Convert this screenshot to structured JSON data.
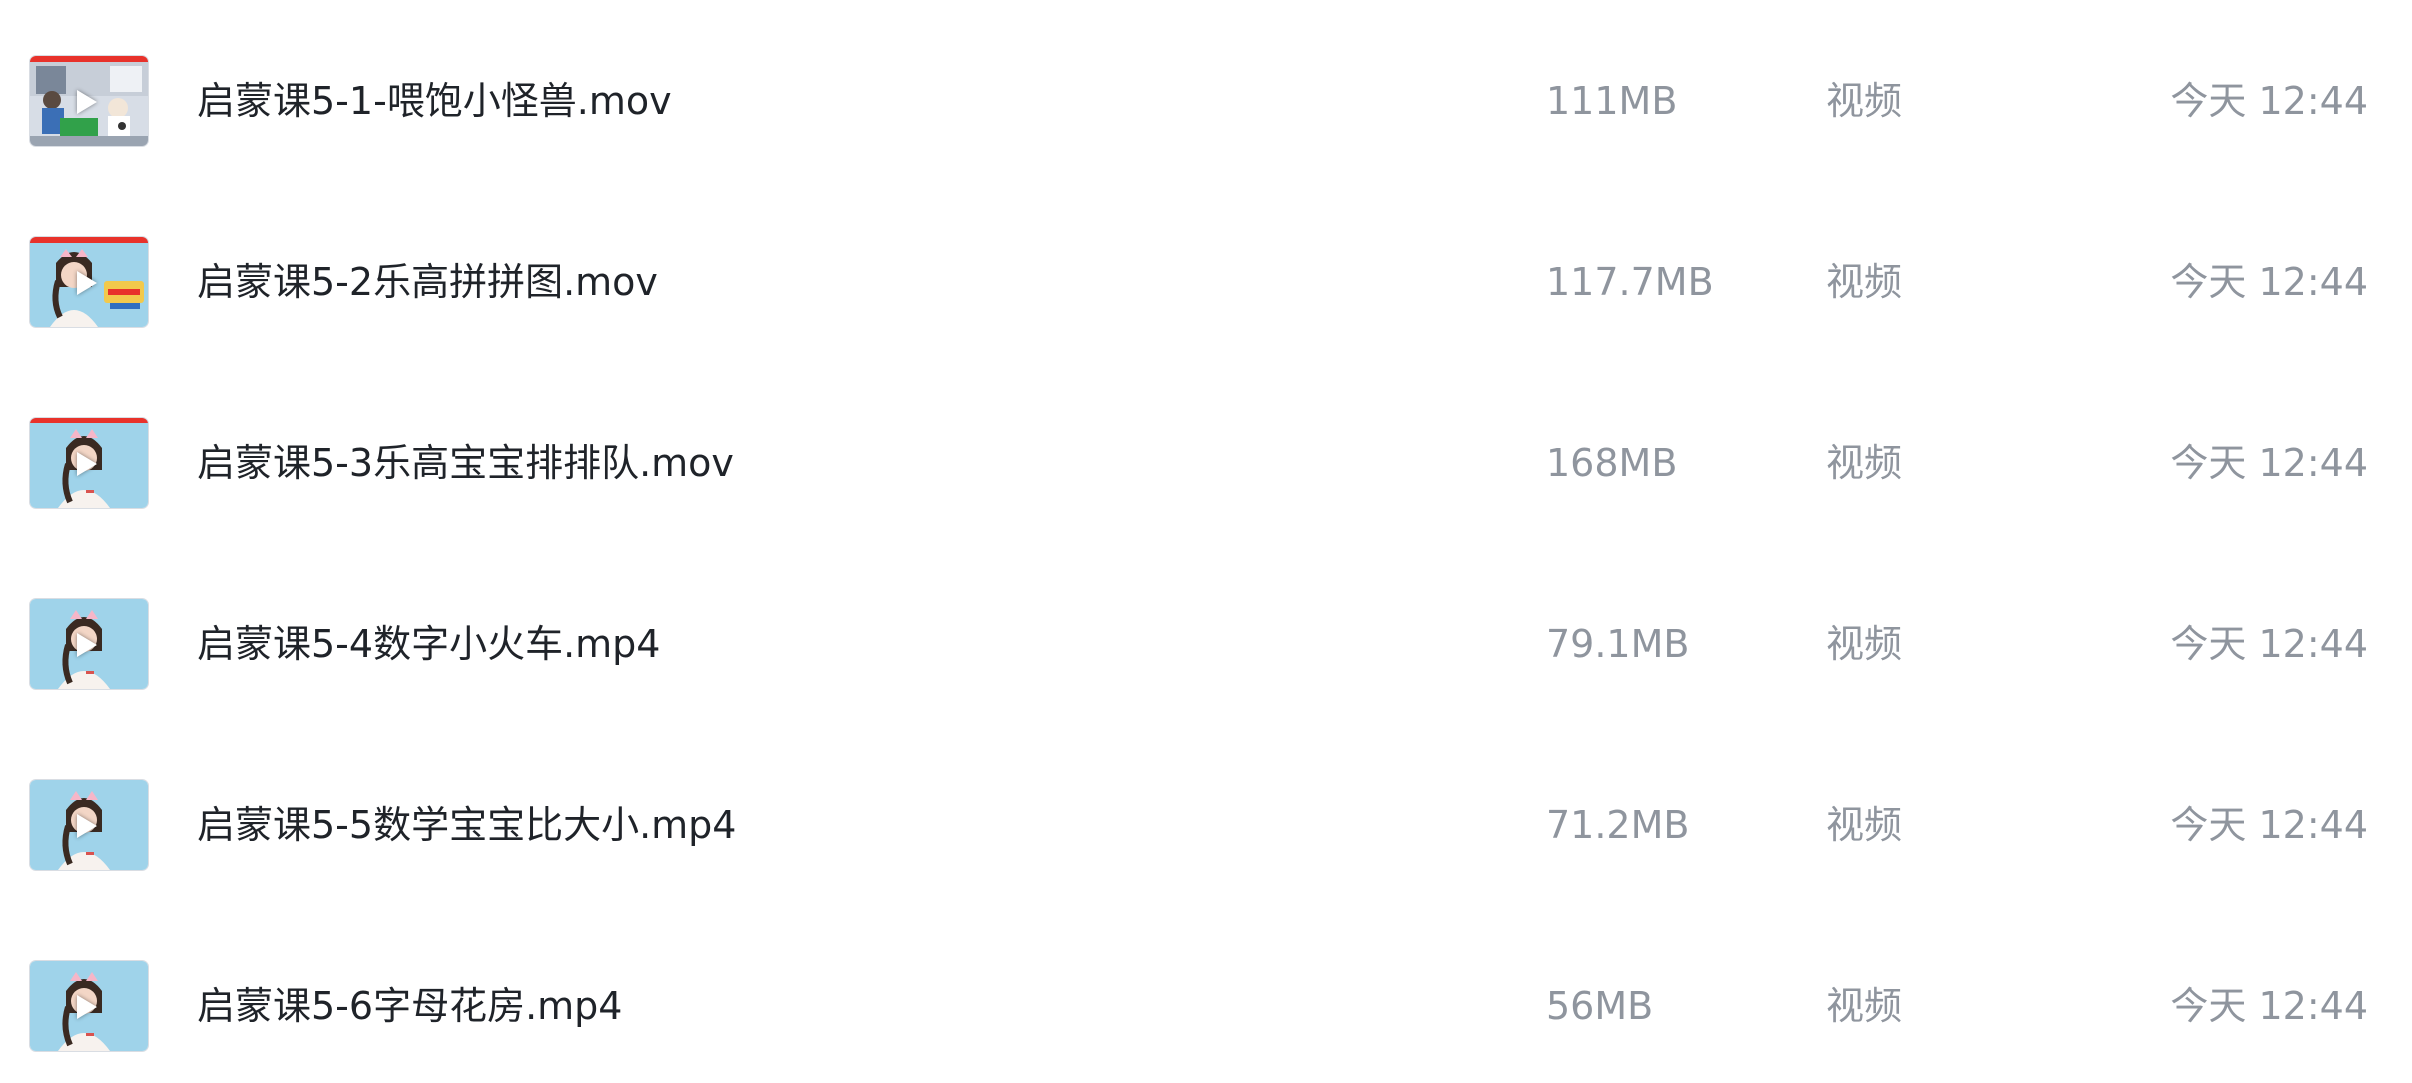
{
  "files": [
    {
      "name": "启蒙课5-1-喂饱小怪兽.mov",
      "size": "111MB",
      "type": "视频",
      "time": "今天 12:44",
      "thumbnail": "video-thumbnail-classroom"
    },
    {
      "name": "启蒙课5-2乐高拼拼图.mov",
      "size": "117.7MB",
      "type": "视频",
      "time": "今天 12:44",
      "thumbnail": "video-thumbnail-teacher-title"
    },
    {
      "name": "启蒙课5-3乐高宝宝排排队.mov",
      "size": "168MB",
      "type": "视频",
      "time": "今天 12:44",
      "thumbnail": "video-thumbnail-teacher"
    },
    {
      "name": "启蒙课5-4数字小火车.mp4",
      "size": "79.1MB",
      "type": "视频",
      "time": "今天 12:44",
      "thumbnail": "video-thumbnail-teacher"
    },
    {
      "name": "启蒙课5-5数学宝宝比大小.mp4",
      "size": "71.2MB",
      "type": "视频",
      "time": "今天 12:44",
      "thumbnail": "video-thumbnail-teacher"
    },
    {
      "name": "启蒙课5-6字母花房.mp4",
      "size": "56MB",
      "type": "视频",
      "time": "今天 12:44",
      "thumbnail": "video-thumbnail-teacher"
    }
  ],
  "colors": {
    "name_text": "#1f2329",
    "meta_text": "#8f959e",
    "thumb_sky": "#9fd3ea",
    "thumb_red_bar": "#e8322b"
  }
}
